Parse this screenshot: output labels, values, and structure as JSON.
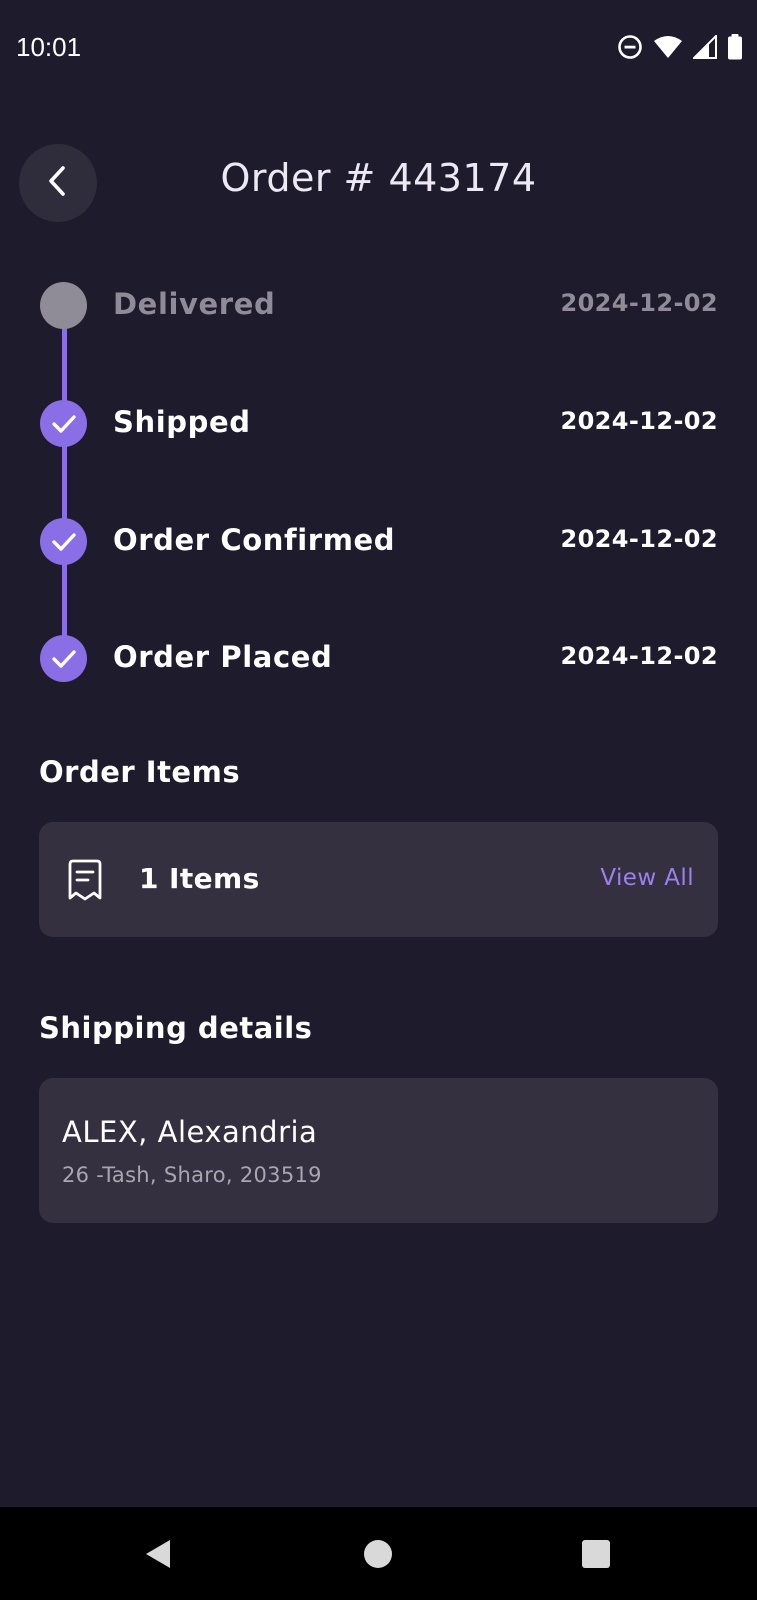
{
  "status_bar": {
    "time": "10:01",
    "icons": [
      "do-not-disturb-icon",
      "wifi-icon",
      "cell-signal-icon",
      "battery-icon"
    ]
  },
  "header": {
    "back_icon": "chevron-left-icon",
    "title": "Order # 443174"
  },
  "timeline": {
    "accent_color": "#8a6ee5",
    "pending_color": "#8f8c98",
    "steps": [
      {
        "label": "Delivered",
        "date": "2024-12-02",
        "completed": false
      },
      {
        "label": "Shipped",
        "date": "2024-12-02",
        "completed": true
      },
      {
        "label": "Order Confirmed",
        "date": "2024-12-02",
        "completed": true
      },
      {
        "label": "Order Placed",
        "date": "2024-12-02",
        "completed": true
      }
    ]
  },
  "order_items": {
    "section_title": "Order Items",
    "icon": "receipt-icon",
    "count_label": "1 Items",
    "view_all_label": "View All"
  },
  "shipping": {
    "section_title": "Shipping details",
    "name": "ALEX, Alexandria",
    "address": "26 -Tash, Sharo, 203519"
  },
  "nav_bar": {
    "buttons": [
      "back-nav-icon",
      "home-nav-icon",
      "recents-nav-icon"
    ]
  }
}
